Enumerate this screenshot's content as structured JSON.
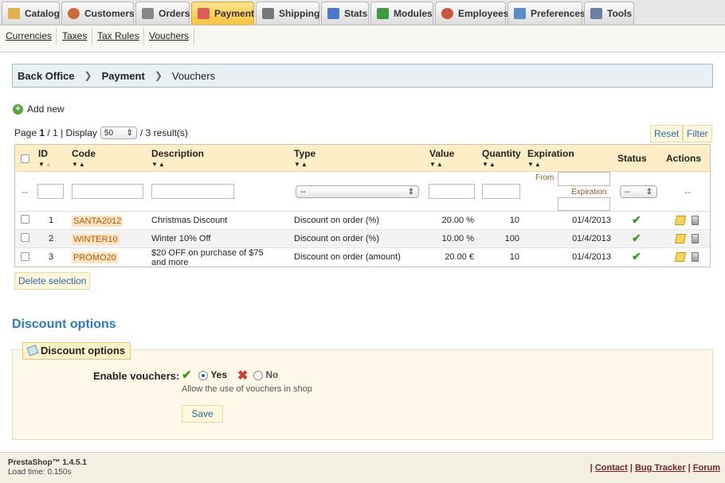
{
  "tabs": [
    {
      "label": "Catalog",
      "icon": "folder-icon",
      "color": "#e0b04a",
      "active": false
    },
    {
      "label": "Customers",
      "icon": "customers-icon",
      "color": "#c96a3a",
      "active": false
    },
    {
      "label": "Orders",
      "icon": "cart-icon",
      "color": "#888888",
      "active": false
    },
    {
      "label": "Payment",
      "icon": "payment-icon",
      "color": "#e05a5a",
      "active": true
    },
    {
      "label": "Shipping",
      "icon": "truck-icon",
      "color": "#777777",
      "active": false
    },
    {
      "label": "Stats",
      "icon": "stats-icon",
      "color": "#4a78c8",
      "active": false
    },
    {
      "label": "Modules",
      "icon": "puzzle-icon",
      "color": "#3f9a3f",
      "active": false
    },
    {
      "label": "Employees",
      "icon": "employees-icon",
      "color": "#c9553a",
      "active": false
    },
    {
      "label": "Preferences",
      "icon": "preferences-icon",
      "color": "#5a8cc8",
      "active": false
    },
    {
      "label": "Tools",
      "icon": "wrench-icon",
      "color": "#6b7fa0",
      "active": false
    }
  ],
  "subnav": [
    "Currencies",
    "Taxes",
    "Tax Rules",
    "Vouchers"
  ],
  "breadcrumb": [
    "Back Office",
    "Payment",
    "Vouchers"
  ],
  "add_new": "Add new",
  "pagination": {
    "page_label": "Page",
    "current": "1",
    "total": "/ 1 | Display",
    "display_value": "50",
    "results": "/ 3 result(s)"
  },
  "buttons": {
    "reset": "Reset",
    "filter": "Filter",
    "delete_selection": "Delete selection",
    "save": "Save"
  },
  "table": {
    "headers": {
      "id": "ID",
      "code": "Code",
      "description": "Description",
      "type": "Type",
      "value": "Value",
      "quantity": "Quantity",
      "expiration": "Expiration",
      "status": "Status",
      "actions": "Actions"
    },
    "filter": {
      "dash": "--",
      "type_select": "--",
      "status_select": "--",
      "actions_dash": "--",
      "from": "From",
      "expiration": "Expiration"
    },
    "rows": [
      {
        "id": "1",
        "code": "SANTA2012",
        "description": "Christmas Discount",
        "type": "Discount on order (%)",
        "value": "20.00 %",
        "quantity": "10",
        "expiration": "01/4/2013"
      },
      {
        "id": "2",
        "code": "WINTER10",
        "description": "Winter 10% Off",
        "type": "Discount on order (%)",
        "value": "10.00 %",
        "quantity": "100",
        "expiration": "01/4/2013"
      },
      {
        "id": "3",
        "code": "PROMO20",
        "description": "$20 OFF on purchase of $75 and more",
        "type": "Discount on order (amount)",
        "value": "20.00 €",
        "quantity": "10",
        "expiration": "01/4/2013"
      }
    ]
  },
  "discount": {
    "section_title": "Discount options",
    "legend": "Discount options",
    "label": "Enable vouchers:",
    "yes": "Yes",
    "no": "No",
    "hint": "Allow the use of vouchers in shop"
  },
  "footer": {
    "version": "PrestaShop™ 1.4.5.1",
    "load": "Load time: 0.150s",
    "links": [
      "Contact",
      "Bug Tracker",
      "Forum"
    ]
  }
}
